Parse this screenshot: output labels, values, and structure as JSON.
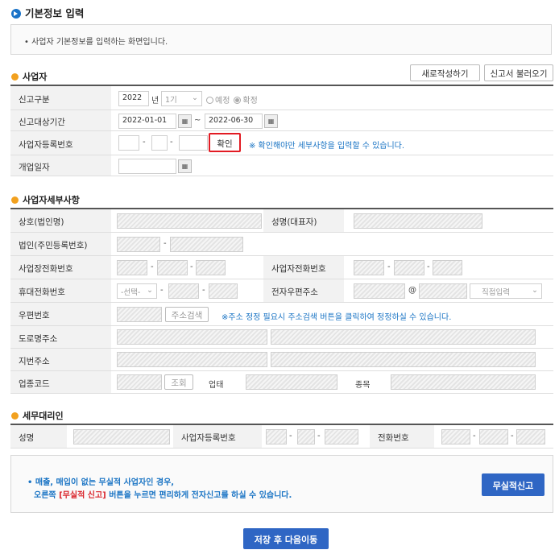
{
  "page": {
    "title": "기본정보 입력",
    "intro": "• 사업자 기본정보를 입력하는 화면입니다."
  },
  "business": {
    "section_title": "사업자",
    "new_button": "새로작성하기",
    "load_button": "신고서 불러오기",
    "report_type": {
      "label": "신고구분",
      "year": "2022",
      "year_unit": "년",
      "period": "1기",
      "opt_planned": "예정",
      "opt_final": "확정",
      "selected": "확정"
    },
    "report_period": {
      "label": "신고대상기간",
      "from": "2022-01-01",
      "tilde": "~",
      "to": "2022-06-30"
    },
    "reg_number": {
      "label": "사업자등록번호",
      "dash": "-",
      "confirm": "확인",
      "hint": "※ 확인해야만 세부사항을 입력할 수 있습니다."
    },
    "open_date": {
      "label": "개업일자"
    }
  },
  "details": {
    "section_title": "사업자세부사항",
    "trade_name": "상호(법인명)",
    "rep_name": "성명(대표자)",
    "corp_number": "법인(주민등록번호)",
    "biz_phone": "사업장전화번호",
    "owner_phone": "사업자전화번호",
    "mobile": "휴대전화번호",
    "mobile_select": "-선택-",
    "email": "전자우편주소",
    "at": "@",
    "email_domain": "직접입력",
    "zip": "우편번호",
    "addr_search": "주소검색",
    "zip_hint": "※주소 정정 필요시 주소검색 버튼을 클릭하여 정정하실 수 있습니다.",
    "road_addr": "도로명주소",
    "lot_addr": "지번주소",
    "industry_code": "업종코드",
    "lookup": "조회",
    "biz_type": "업태",
    "biz_item": "종목"
  },
  "agent": {
    "section_title": "세무대리인",
    "name": "성명",
    "reg_number": "사업자등록번호",
    "phone": "전화번호"
  },
  "notice": {
    "line1": "• 매출, 매입이 없는 무실적 사업자인 경우,",
    "line2_prefix": "오른쪽 ",
    "line2_highlight": "[무실적 신고]",
    "line2_suffix": " 버튼을 누르면 편리하게 전자신고를 하실 수 있습니다.",
    "zero_button": "무실적신고"
  },
  "save_button": "저장 후 다음이동",
  "colors": {
    "accent": "#2f66c4",
    "bullet": "#f2a11f",
    "hint": "#1a74c4",
    "highlight": "#d9232a"
  }
}
